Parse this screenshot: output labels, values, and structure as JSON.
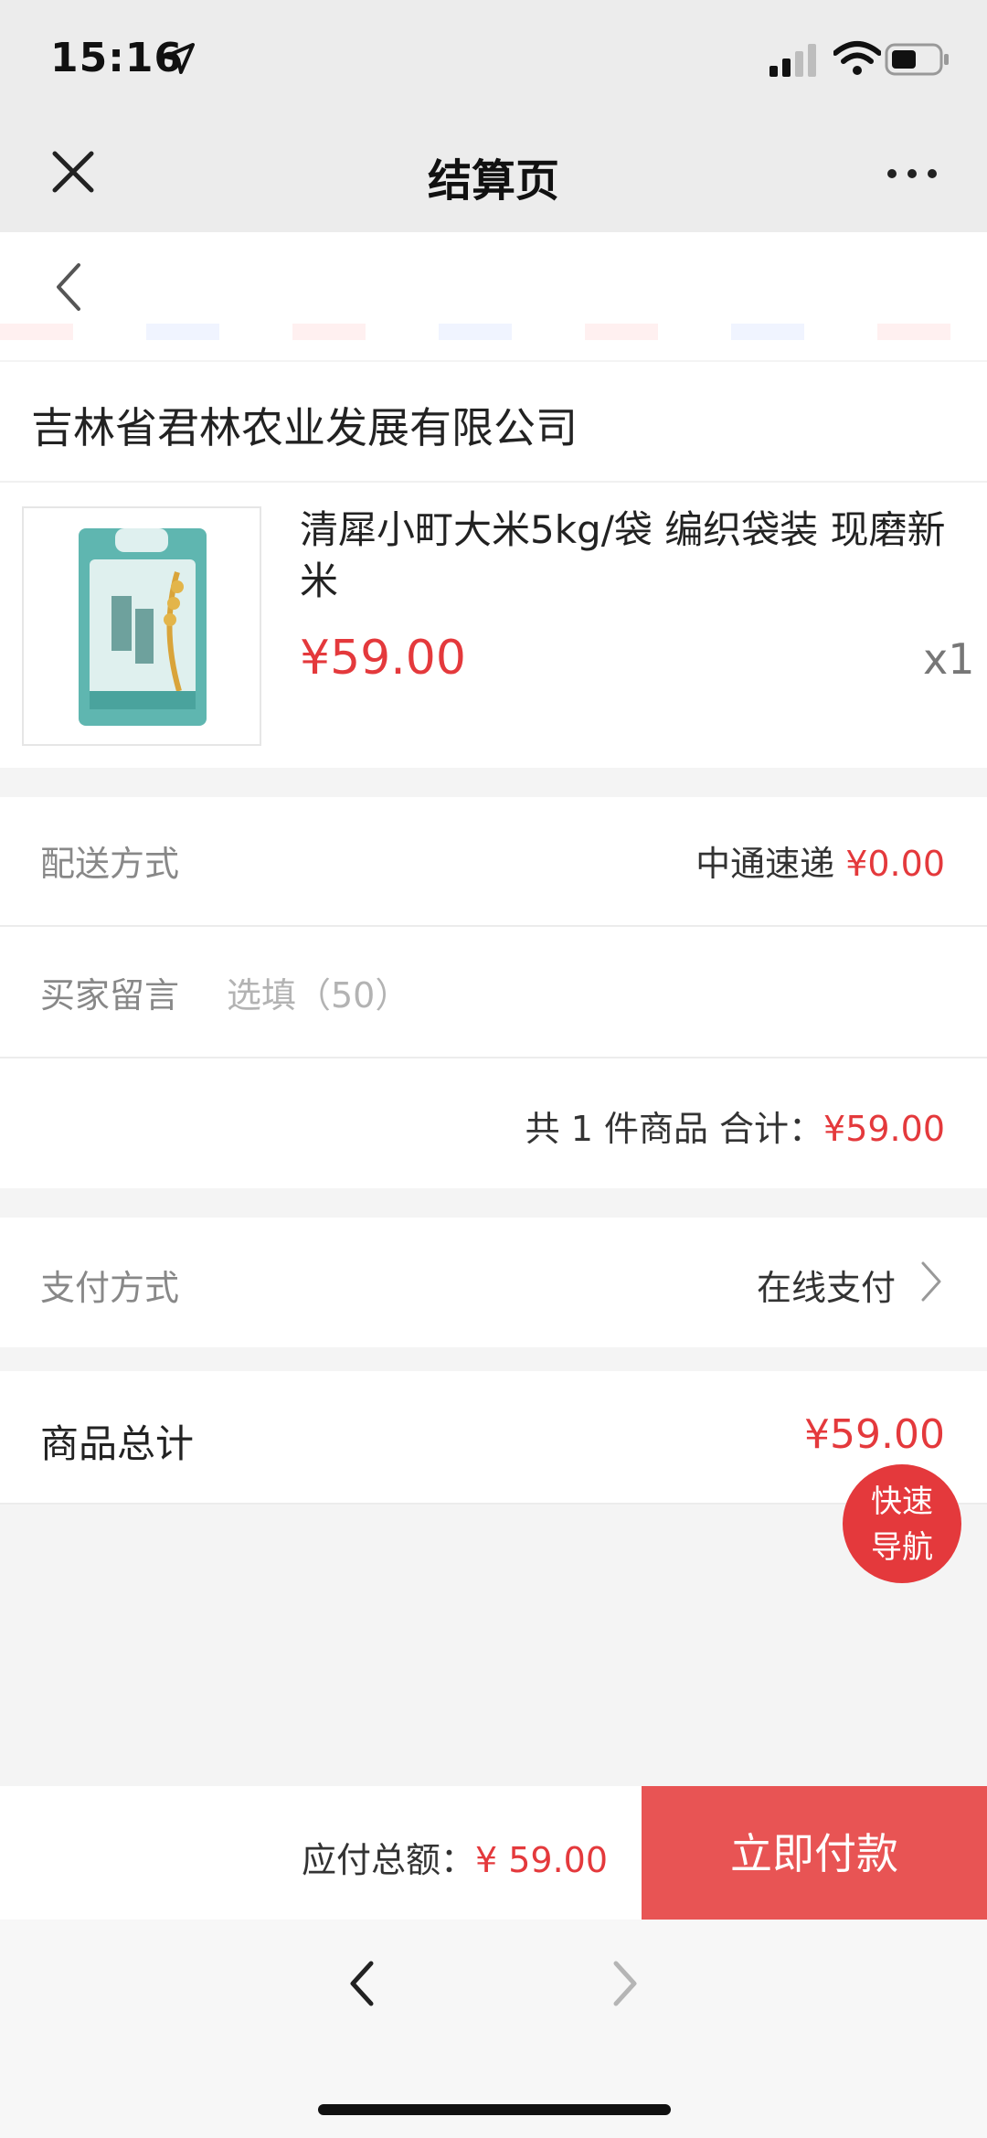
{
  "status_bar": {
    "time": "15:16",
    "icons": [
      "location-arrow-icon",
      "signal-icon",
      "wifi-icon",
      "battery-icon"
    ]
  },
  "titlebar": {
    "title": "结算页",
    "icons": [
      "close-icon",
      "more-icon"
    ]
  },
  "shop": {
    "name": "吉林省君林农业发展有限公司"
  },
  "product": {
    "title": "清犀小町大米5kg/袋 编织袋装 现磨新米",
    "price": "¥59.00",
    "quantity": "x1"
  },
  "shipping": {
    "label": "配送方式",
    "carrier": "中通速递",
    "fee": "¥0.00"
  },
  "message": {
    "label": "买家留言",
    "placeholder": "选填（50）"
  },
  "summary": {
    "count_text": "共 1 件商品  合计：",
    "amount": "¥59.00"
  },
  "payment": {
    "label": "支付方式",
    "value": "在线支付"
  },
  "total": {
    "label": "商品总计",
    "amount": "¥59.00"
  },
  "fab": {
    "line1": "快速",
    "line2": "导航"
  },
  "bottom_bar": {
    "due_label": "应付总额：",
    "due_amount": "¥ 59.00",
    "pay_button": "立即付款"
  },
  "colors": {
    "accent_red": "#e4393c",
    "pay_button_bg": "#e85454",
    "bar_bg": "#ececec"
  }
}
